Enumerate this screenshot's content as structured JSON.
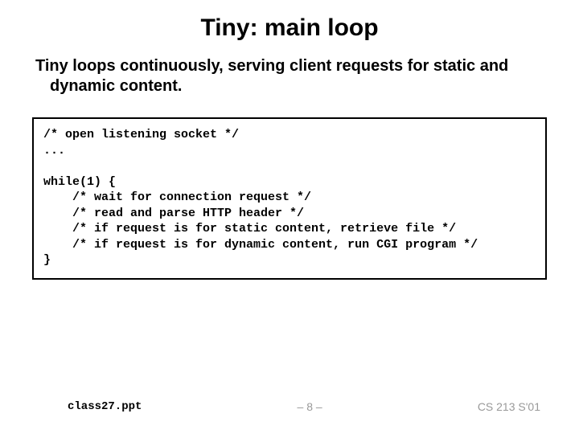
{
  "title": "Tiny: main loop",
  "subtitle": "Tiny loops continuously, serving client requests for static and dynamic content.",
  "code": "/* open listening socket */\n...\n\nwhile(1) {\n    /* wait for connection request */\n    /* read and parse HTTP header */\n    /* if request is for static content, retrieve file */\n    /* if request is for dynamic content, run CGI program */\n}",
  "footer": {
    "left": "class27.ppt",
    "center": "– 8 –",
    "right": "CS 213 S'01"
  }
}
